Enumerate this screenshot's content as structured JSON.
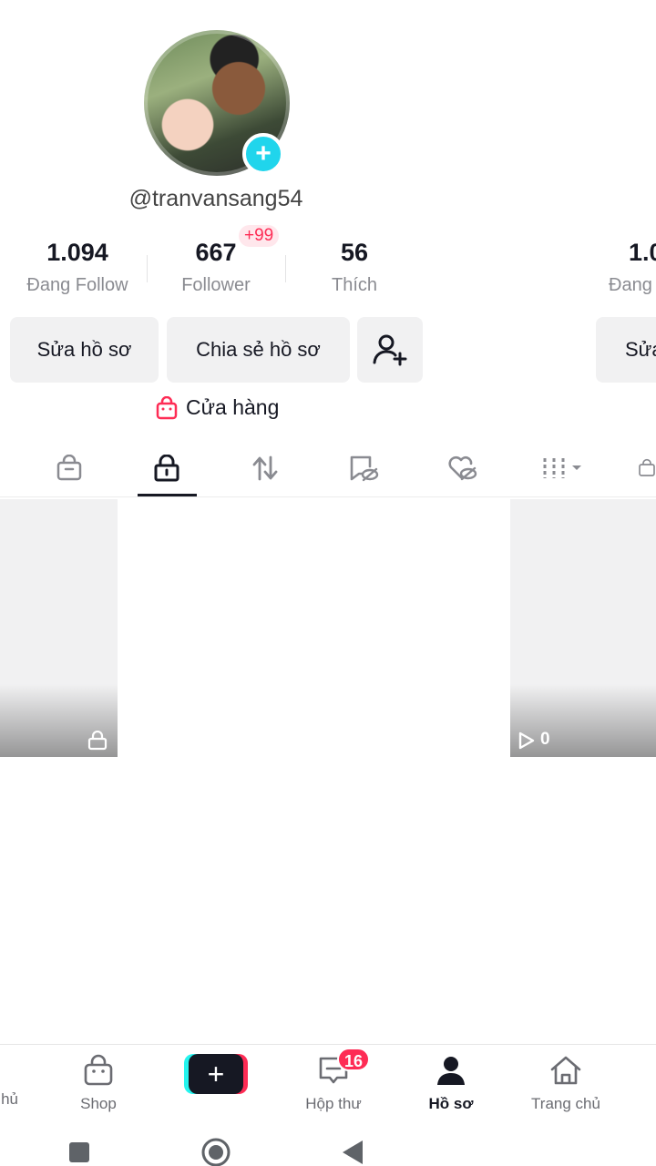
{
  "profile": {
    "username": "@tranvansang54",
    "stats": [
      {
        "value": "1.094",
        "label": "Đang Follow"
      },
      {
        "value": "667",
        "label": "Follower"
      },
      {
        "value": "56",
        "label": "Thích"
      }
    ],
    "follower_badge": "+99"
  },
  "next_profile_peek": {
    "stat_value": "1.0",
    "stat_label": "Đang",
    "button_label": "Sửa"
  },
  "buttons": {
    "edit_profile": "Sửa hồ sơ",
    "share_profile": "Chia sẻ hồ sơ"
  },
  "shop_link": "Cửa hàng",
  "tabs": [
    "shop-bag-icon",
    "private-lock-icon",
    "repost-icon",
    "saved-icon",
    "liked-hidden-icon",
    "filter-grid-icon",
    "shop-bag-icon-partial"
  ],
  "tiles": [
    {
      "kind": "private"
    },
    {
      "kind": "video",
      "views": "0"
    }
  ],
  "bottom_nav": {
    "partial_left": "hủ",
    "shop": "Shop",
    "inbox": "Hộp thư",
    "inbox_badge": "16",
    "profile": "Hồ sơ",
    "home": "Trang chủ"
  },
  "colors": {
    "accent": "#fe2c55",
    "cyan": "#25f4ee",
    "avatar_plus": "#20d5ec",
    "text": "#161823",
    "muted": "#8a8b91"
  }
}
